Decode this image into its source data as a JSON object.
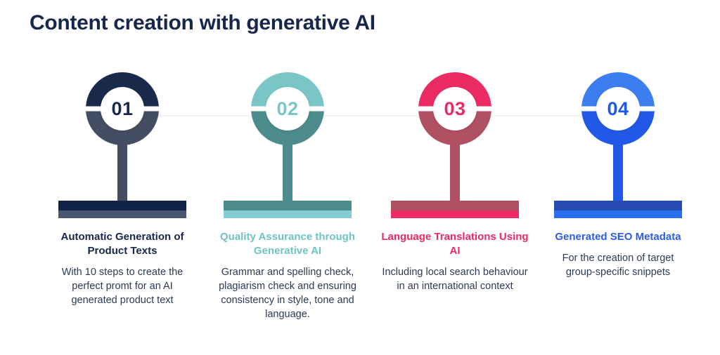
{
  "title": "Content creation with generative AI",
  "colors": {
    "background": "#ffffff",
    "title_color": "#17264b",
    "connector_line": "#f2f2f5",
    "body_text": "#2c3a55"
  },
  "steps": [
    {
      "number": "01",
      "heading": "Automatic Generation of Product Texts",
      "body": "With 10 steps to create the perfect promt for an AI generated product text",
      "accent_light": "#1a2a4a",
      "accent_dark": "#434e63",
      "base_top": "#12234a",
      "base_bottom": "#4a5670",
      "number_color": "#1a2a4a",
      "heading_color": "#17264b"
    },
    {
      "number": "02",
      "heading": "Quality Assurance through Generative AI",
      "body": "Grammar and spelling check, plagiarism check and ensuring consistency in style, tone and language.",
      "accent_light": "#7ac6c6",
      "accent_dark": "#4d8c8c",
      "base_top": "#4d8c8c",
      "base_bottom": "#84cdd2",
      "number_color": "#7ac6c6",
      "heading_color": "#6ec3c3"
    },
    {
      "number": "03",
      "heading": "Language Translations Using AI",
      "body": "Including local search behaviour in an international context",
      "accent_light": "#ec2a63",
      "accent_dark": "#b05063",
      "base_top": "#b05063",
      "base_bottom": "#ec2a63",
      "number_color": "#ec2a63",
      "heading_color": "#ed2864"
    },
    {
      "number": "04",
      "heading": "Generated SEO Metadata",
      "body": "For the creation of target group-specific snippets",
      "accent_light": "#3b7ef0",
      "accent_dark": "#2158e8",
      "base_top": "#264bb0",
      "base_bottom": "#2a6ef0",
      "number_color": "#2158e8",
      "heading_color": "#2b5ce6"
    }
  ]
}
